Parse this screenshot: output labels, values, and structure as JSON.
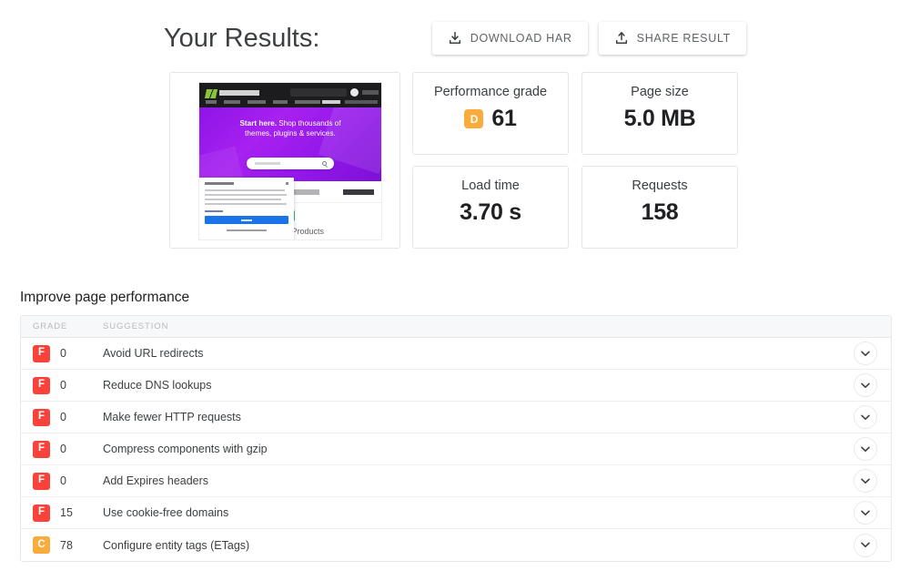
{
  "header": {
    "title": "Your Results:",
    "actions": [
      {
        "label": "DOWNLOAD HAR",
        "icon": "download-icon"
      },
      {
        "label": "SHARE RESULT",
        "icon": "share-upload-icon"
      }
    ]
  },
  "thumbnail": {
    "alt": "page-screenshot-thumbnail",
    "hero_title_bold": "Start here.",
    "hero_title_rest": " Shop thousands of",
    "hero_title_line2": "themes, plugins & services.",
    "featured_label": "Featured Products"
  },
  "metrics": [
    {
      "label": "Performance grade",
      "value": "61",
      "grade": "D",
      "grade_color": "#f9ab3c"
    },
    {
      "label": "Page size",
      "value": "5.0 MB",
      "grade": null,
      "grade_color": null
    },
    {
      "label": "Load time",
      "value": "3.70 s",
      "grade": null,
      "grade_color": null
    },
    {
      "label": "Requests",
      "value": "158",
      "grade": null,
      "grade_color": null
    }
  ],
  "improve": {
    "title": "Improve page performance",
    "columns": {
      "grade": "GRADE",
      "suggestion": "SUGGESTION"
    },
    "colors": {
      "grade_f": "#f9423a",
      "grade_c": "#f9ab3c",
      "grade_d": "#f9ab3c"
    },
    "rows": [
      {
        "grade": "F",
        "grade_color": "#f9423a",
        "score": "0",
        "suggestion": "Avoid URL redirects"
      },
      {
        "grade": "F",
        "grade_color": "#f9423a",
        "score": "0",
        "suggestion": "Reduce DNS lookups"
      },
      {
        "grade": "F",
        "grade_color": "#f9423a",
        "score": "0",
        "suggestion": "Make fewer HTTP requests"
      },
      {
        "grade": "F",
        "grade_color": "#f9423a",
        "score": "0",
        "suggestion": "Compress components with gzip"
      },
      {
        "grade": "F",
        "grade_color": "#f9423a",
        "score": "0",
        "suggestion": "Add Expires headers"
      },
      {
        "grade": "F",
        "grade_color": "#f9423a",
        "score": "15",
        "suggestion": "Use cookie-free domains"
      },
      {
        "grade": "C",
        "grade_color": "#f9ab3c",
        "score": "78",
        "suggestion": "Configure entity tags (ETags)"
      }
    ],
    "expand_icon": "chevron-down-icon"
  }
}
